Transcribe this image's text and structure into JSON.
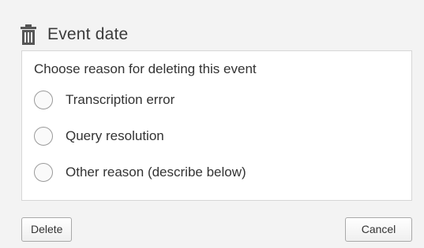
{
  "dialog": {
    "title": "Event date",
    "prompt": "Choose reason for deleting this event",
    "options": [
      {
        "label": "Transcription error",
        "selected": false
      },
      {
        "label": "Query resolution",
        "selected": false
      },
      {
        "label": "Other reason (describe below)",
        "selected": false
      }
    ],
    "delete_label": "Delete",
    "cancel_label": "Cancel",
    "icon": "trash-icon"
  },
  "colors": {
    "background": "#f3f3f3",
    "panel": "#ffffff",
    "border": "#d6d6d6",
    "text": "#333333"
  }
}
